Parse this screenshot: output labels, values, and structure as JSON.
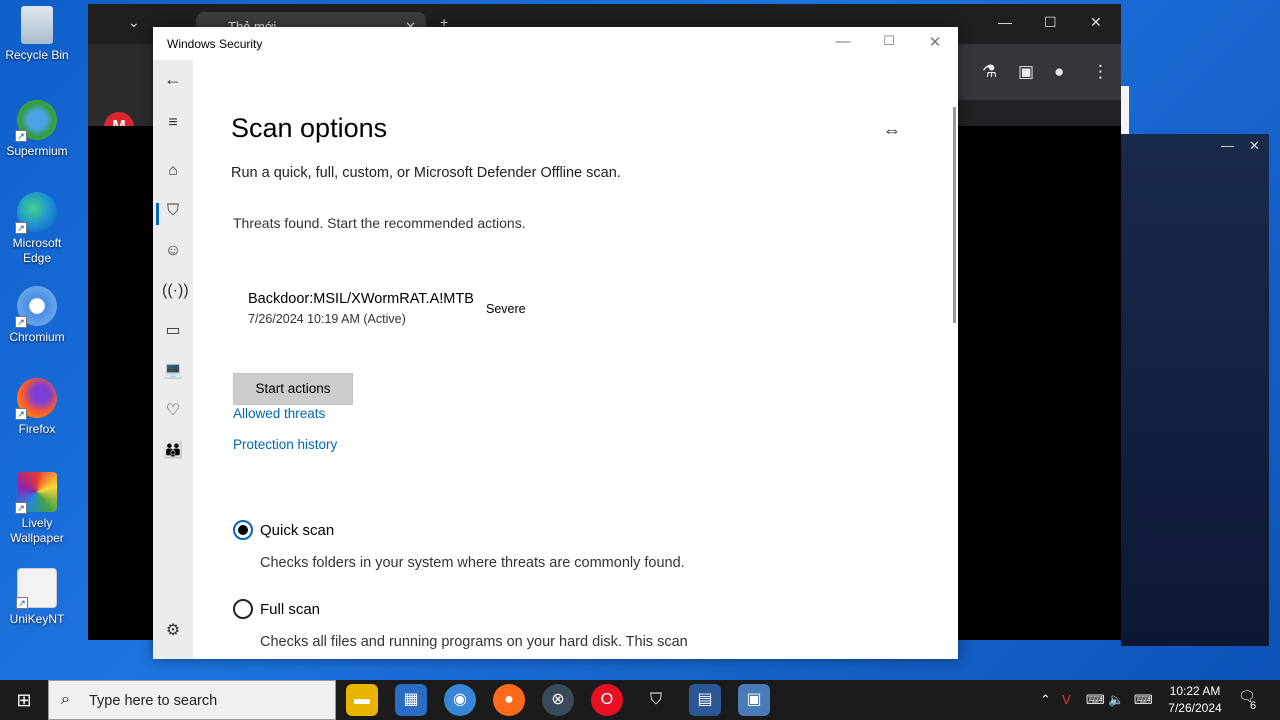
{
  "desktop": {
    "icons": [
      {
        "label": "Recycle Bin",
        "icon": "recycle-bin-icon"
      },
      {
        "label": "Supermium",
        "icon": "supermium-icon"
      },
      {
        "label": "Microsoft Edge",
        "icon": "edge-icon"
      },
      {
        "label": "Chromium",
        "icon": "chromium-icon"
      },
      {
        "label": "Firefox",
        "icon": "firefox-icon"
      },
      {
        "label": "Lively Wallpaper",
        "icon": "lively-icon"
      },
      {
        "label": "UniKeyNT",
        "icon": "unikey-icon"
      }
    ]
  },
  "browser": {
    "tab_title": "Thẻ mới",
    "logo_letter": "M"
  },
  "window": {
    "title": "Windows Security",
    "colors": {
      "accent": "#0067c0",
      "link": "#0067b8"
    }
  },
  "page": {
    "heading": "Scan options",
    "subtitle": "Run a quick, full, custom, or Microsoft Defender Offline scan.",
    "threat_notice": "Threats found. Start the recommended actions.",
    "threat": {
      "name": "Backdoor:MSIL/XWormRAT.A!MTB",
      "date": "7/26/2024 10:19 AM (Active)",
      "severity": "Severe"
    },
    "start_actions_label": "Start actions",
    "links": {
      "allowed_threats": "Allowed threats",
      "protection_history": "Protection history"
    },
    "options": [
      {
        "label": "Quick scan",
        "desc": "Checks folders in your system where threats are commonly found.",
        "checked": true
      },
      {
        "label": "Full scan",
        "desc": "Checks all files and running programs on your hard disk. This scan",
        "checked": false
      }
    ]
  },
  "taskbar": {
    "search_placeholder": "Type here to search",
    "time": "10:22 AM",
    "date": "7/26/2024",
    "notification_count": "6"
  }
}
